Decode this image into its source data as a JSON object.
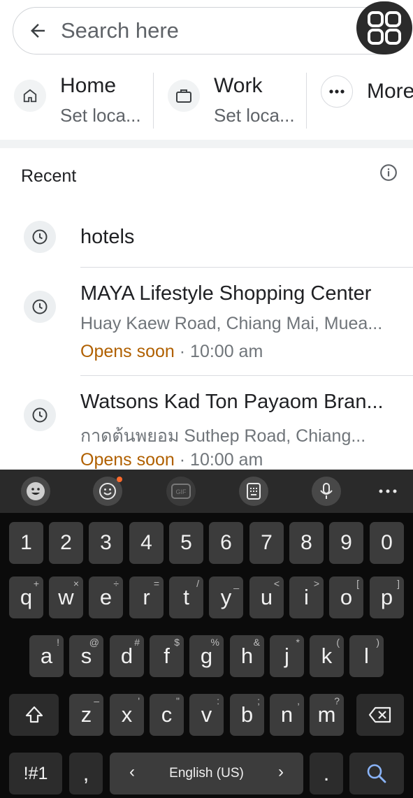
{
  "search": {
    "placeholder": "Search here"
  },
  "shortcuts": [
    {
      "title": "Home",
      "subtitle": "Set loca..."
    },
    {
      "title": "Work",
      "subtitle": "Set loca..."
    },
    {
      "title": "More"
    }
  ],
  "recent": {
    "heading": "Recent",
    "items": [
      {
        "name": "hotels"
      },
      {
        "name": "MAYA Lifestyle Shopping Center",
        "address": "Huay Kaew Road, Chiang Mai, Muea...",
        "status": "Opens soon",
        "time": " · 10:00 am"
      },
      {
        "name": "Watsons Kad Ton Payaom Bran...",
        "address": "กาดต้นพยอม Suthep Road, Chiang...",
        "status": "Opens soon",
        "time": " · 10:00 am"
      }
    ]
  },
  "keyboard": {
    "numbers": [
      "1",
      "2",
      "3",
      "4",
      "5",
      "6",
      "7",
      "8",
      "9",
      "0"
    ],
    "row1": [
      [
        "q",
        "+"
      ],
      [
        "w",
        "×"
      ],
      [
        "e",
        "÷"
      ],
      [
        "r",
        "="
      ],
      [
        "t",
        "/"
      ],
      [
        "y",
        "_"
      ],
      [
        "u",
        "<"
      ],
      [
        "i",
        ">"
      ],
      [
        "o",
        "["
      ],
      [
        "p",
        "]"
      ]
    ],
    "row2": [
      [
        "a",
        "!"
      ],
      [
        "s",
        "@"
      ],
      [
        "d",
        "#"
      ],
      [
        "f",
        "$"
      ],
      [
        "g",
        "%"
      ],
      [
        "h",
        "&"
      ],
      [
        "j",
        "*"
      ],
      [
        "k",
        "("
      ],
      [
        "l",
        ")"
      ]
    ],
    "row3": [
      [
        "z",
        "–"
      ],
      [
        "x",
        "'"
      ],
      [
        "c",
        "\""
      ],
      [
        "v",
        ":"
      ],
      [
        "b",
        ";"
      ],
      [
        "n",
        ","
      ],
      [
        "m",
        "?"
      ]
    ],
    "symbols_label": "!#1",
    "comma": ",",
    "space_label": "English (US)",
    "period": ".",
    "accent_color": "#8ab4f8",
    "status_color": "#b06000"
  }
}
